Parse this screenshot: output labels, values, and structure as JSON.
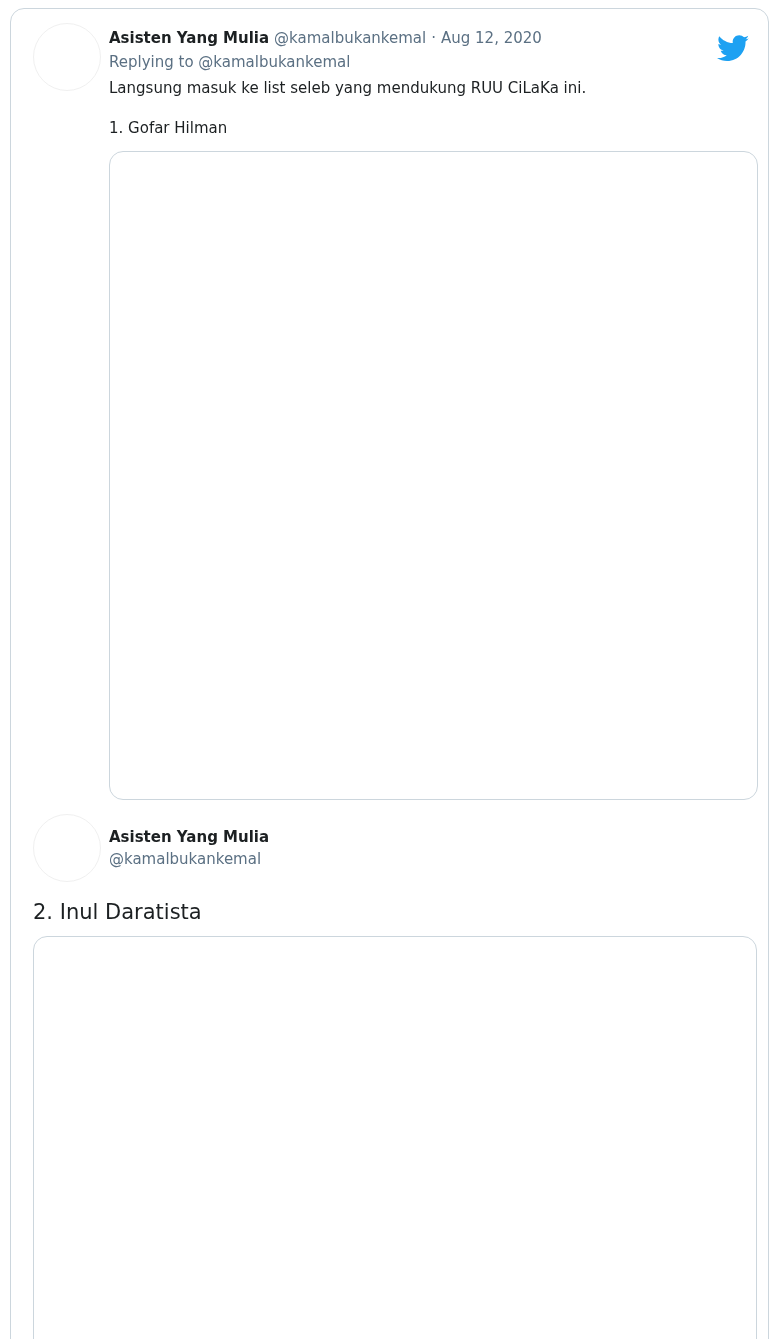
{
  "tweet": {
    "author": {
      "name": "Asisten Yang Mulia",
      "handle": "@kamalbukankemal"
    },
    "separator": "·",
    "date": "Aug 12, 2020",
    "replying_to": "Replying to @kamalbukankemal",
    "text": [
      "Langsung masuk ke list seleb yang mendukung RUU CiLaKa ini.",
      "1. Gofar Hilman"
    ],
    "media": {
      "kind": "empty"
    }
  },
  "quoted": {
    "author": {
      "name": "Asisten Yang Mulia",
      "handle": "@kamalbukankemal"
    },
    "text": "2. Inul Daratista",
    "media": {
      "kind": "empty"
    }
  }
}
